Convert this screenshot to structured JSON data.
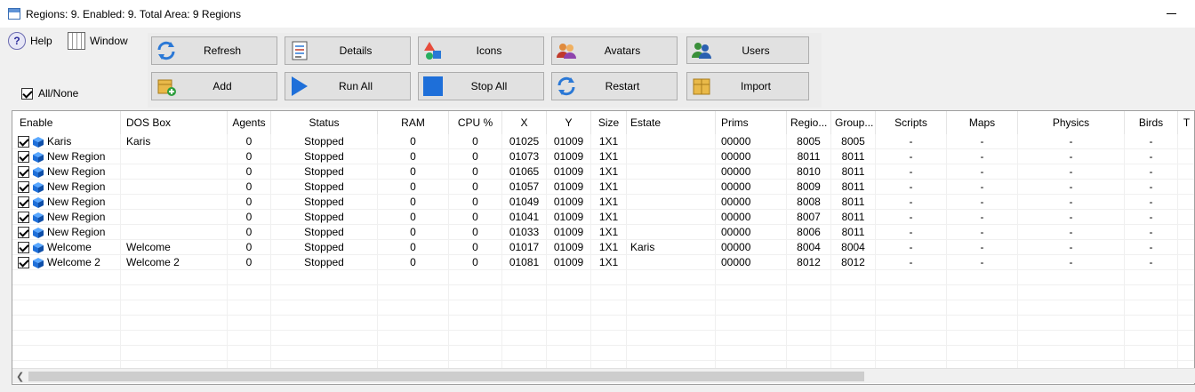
{
  "window": {
    "title": "Regions:  9.  Enabled: 9. Total Area: 9 Regions"
  },
  "menu": {
    "help": "Help",
    "window": "Window"
  },
  "toolbar": {
    "refresh": "Refresh",
    "details": "Details",
    "icons": "Icons",
    "avatars": "Avatars",
    "users": "Users",
    "add": "Add",
    "run_all": "Run All",
    "stop_all": "Stop All",
    "restart": "Restart",
    "import": "Import"
  },
  "all_none": {
    "label": "All/None",
    "checked": true
  },
  "columns": [
    "Enable",
    "DOS Box",
    "Agents",
    "Status",
    "RAM",
    "CPU %",
    "X",
    "Y",
    "Size",
    "Estate",
    "Prims",
    "Regio...",
    "Group...",
    "Scripts",
    "Maps",
    "Physics",
    "Birds",
    "T"
  ],
  "rows": [
    [
      "Karis",
      "Karis",
      "0",
      "Stopped",
      "0",
      "0",
      "01025",
      "01009",
      "1X1",
      "",
      "00000",
      "8005",
      "8005",
      "-",
      "-",
      "-",
      "-"
    ],
    [
      "New Region",
      "",
      "0",
      "Stopped",
      "0",
      "0",
      "01073",
      "01009",
      "1X1",
      "",
      "00000",
      "8011",
      "8011",
      "-",
      "-",
      "-",
      "-"
    ],
    [
      "New Region",
      "",
      "0",
      "Stopped",
      "0",
      "0",
      "01065",
      "01009",
      "1X1",
      "",
      "00000",
      "8010",
      "8011",
      "-",
      "-",
      "-",
      "-"
    ],
    [
      "New Region",
      "",
      "0",
      "Stopped",
      "0",
      "0",
      "01057",
      "01009",
      "1X1",
      "",
      "00000",
      "8009",
      "8011",
      "-",
      "-",
      "-",
      "-"
    ],
    [
      "New Region",
      "",
      "0",
      "Stopped",
      "0",
      "0",
      "01049",
      "01009",
      "1X1",
      "",
      "00000",
      "8008",
      "8011",
      "-",
      "-",
      "-",
      "-"
    ],
    [
      "New Region",
      "",
      "0",
      "Stopped",
      "0",
      "0",
      "01041",
      "01009",
      "1X1",
      "",
      "00000",
      "8007",
      "8011",
      "-",
      "-",
      "-",
      "-"
    ],
    [
      "New Region",
      "",
      "0",
      "Stopped",
      "0",
      "0",
      "01033",
      "01009",
      "1X1",
      "",
      "00000",
      "8006",
      "8011",
      "-",
      "-",
      "-",
      "-"
    ],
    [
      "Welcome",
      "Welcome",
      "0",
      "Stopped",
      "0",
      "0",
      "01017",
      "01009",
      "1X1",
      "Karis",
      "00000",
      "8004",
      "8004",
      "-",
      "-",
      "-",
      "-"
    ],
    [
      "Welcome 2",
      "Welcome 2",
      "0",
      "Stopped",
      "0",
      "0",
      "01081",
      "01009",
      "1X1",
      "",
      "00000",
      "8012",
      "8012",
      "-",
      "-",
      "-",
      "-"
    ]
  ],
  "colors": {
    "accent": "#1e6fd9",
    "grid_border": "#a0a0a0",
    "button_face": "#e1e1e1"
  },
  "icons": [
    "window-icon",
    "help-icon",
    "grid-window-icon",
    "refresh-icon",
    "details-icon",
    "shapes-icon",
    "avatars-icon",
    "users-icon",
    "add-box-icon",
    "play-icon",
    "stop-icon",
    "restart-icon",
    "import-box-icon",
    "region-cube-icon",
    "scroll-left-icon"
  ]
}
